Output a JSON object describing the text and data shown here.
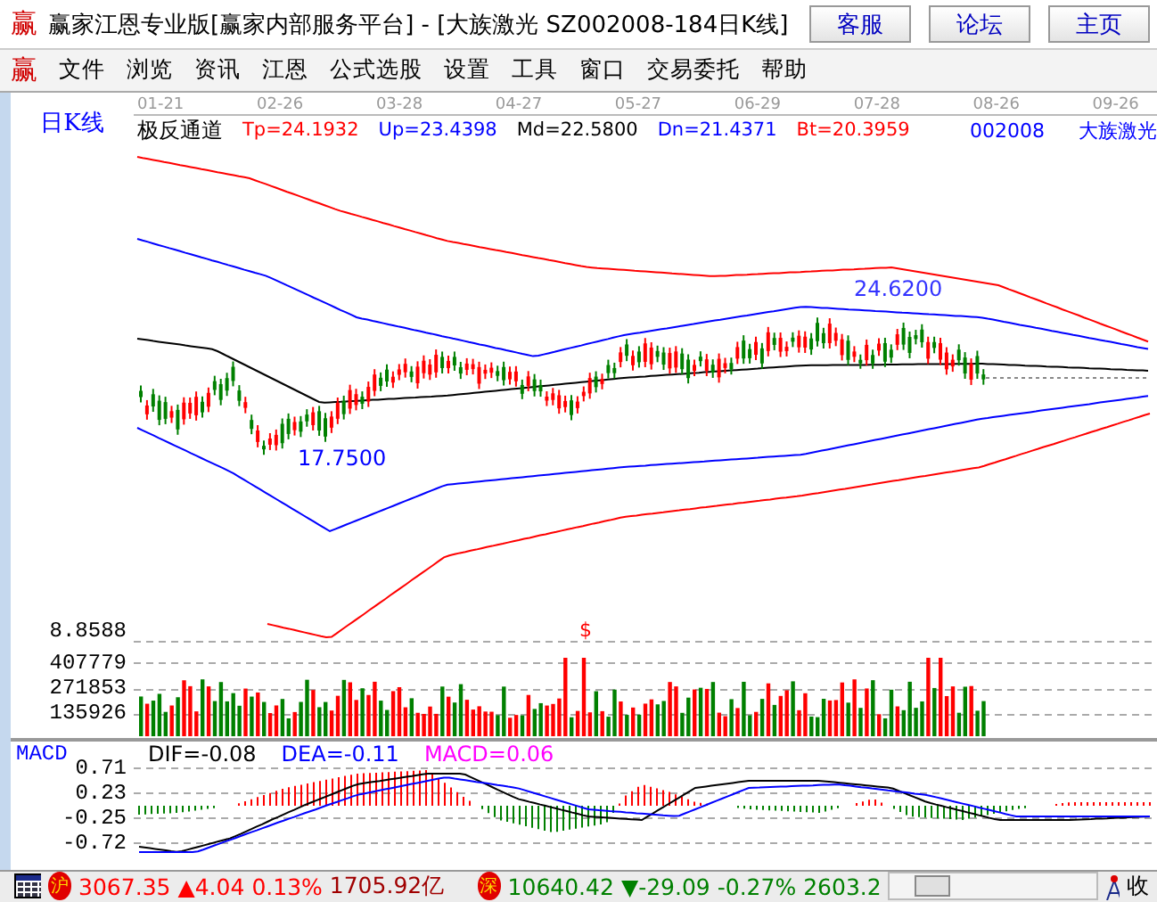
{
  "window": {
    "logo": "赢",
    "title": "赢家江恩专业版[赢家内部服务平台] - [大族激光  SZ002008-184日K线]",
    "buttons": [
      "客服",
      "论坛",
      "主页"
    ]
  },
  "menu": {
    "logo": "赢",
    "items": [
      "文件",
      "浏览",
      "资讯",
      "江恩",
      "公式选股",
      "设置",
      "工具",
      "窗口",
      "交易委托",
      "帮助"
    ]
  },
  "sidebar": {
    "label": "日K线"
  },
  "chart": {
    "dates": [
      "01-21",
      "02-26",
      "03-28",
      "04-27",
      "05-27",
      "06-29",
      "07-28",
      "08-26",
      "09-26"
    ],
    "indicator": "极反通道",
    "values": [
      {
        "label": "Tp=24.1932",
        "color": "#ff0000"
      },
      {
        "label": "Up=23.4398",
        "color": "#0000ff"
      },
      {
        "label": "Md=22.5800",
        "color": "#000000"
      },
      {
        "label": "Dn=21.4371",
        "color": "#0000ff"
      },
      {
        "label": "Bt=20.3959",
        "color": "#ff0000"
      }
    ],
    "code": "002008",
    "name": "大族激光",
    "low_label": "17.7500",
    "high_label": "24.6200",
    "marker": "$",
    "axis_label": "8.8588"
  },
  "volume": {
    "ticks": [
      "407779",
      "271853",
      "135926"
    ]
  },
  "macd": {
    "title": "MACD",
    "values": [
      {
        "label": "DIF=-0.08",
        "color": "#000000"
      },
      {
        "label": "DEA=-0.11",
        "color": "#0000ff"
      },
      {
        "label": "MACD=0.06",
        "color": "#ff00ff"
      }
    ],
    "ticks": [
      "0.71",
      "0.23",
      "-0.25",
      "-0.72"
    ]
  },
  "status_bar": {
    "indices": [
      {
        "badge": "沪",
        "index": "3067.35",
        "change": "▲4.04",
        "percent": "0.13%",
        "amount": "1705.92亿",
        "color": "#ff0000"
      },
      {
        "badge": "深",
        "index": "10640.42",
        "change": "▼-29.09",
        "percent": "-0.27%",
        "amount": "2603.2",
        "color": "#008000"
      }
    ],
    "tail": "收"
  }
}
